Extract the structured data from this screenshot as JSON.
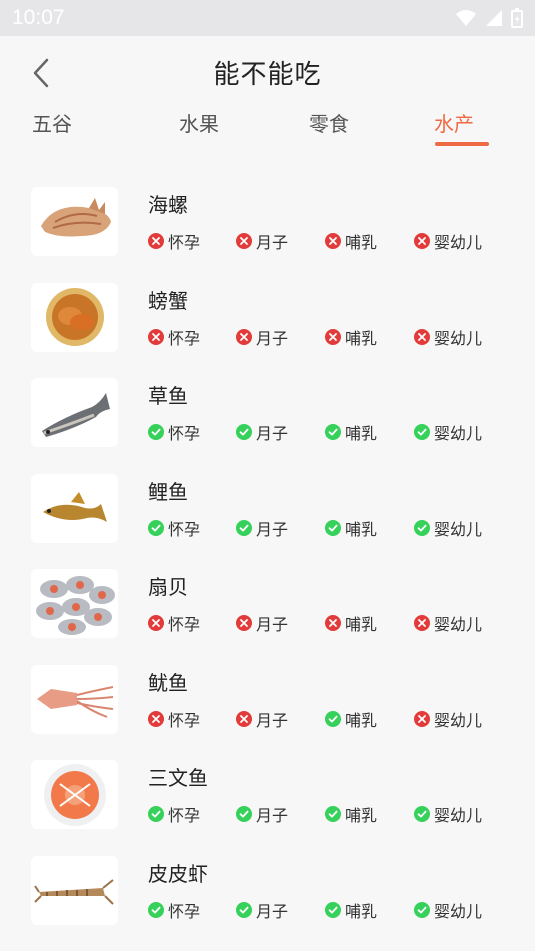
{
  "status": {
    "time": "10:07"
  },
  "header": {
    "title": "能不能吃"
  },
  "tabs": [
    {
      "label": "五谷",
      "active": false
    },
    {
      "label": "水果",
      "active": false
    },
    {
      "label": "零食",
      "active": false
    },
    {
      "label": "水产",
      "active": true
    }
  ],
  "colors": {
    "accent": "#ee6a43",
    "ok": "#36d15a",
    "no": "#e23b3b"
  },
  "items": [
    {
      "name": "海螺",
      "image": "conch-image",
      "flags": [
        {
          "label": "怀孕",
          "ok": false
        },
        {
          "label": "月子",
          "ok": false
        },
        {
          "label": "哺乳",
          "ok": false
        },
        {
          "label": "婴幼儿",
          "ok": false
        }
      ]
    },
    {
      "name": "螃蟹",
      "image": "crab-image",
      "flags": [
        {
          "label": "怀孕",
          "ok": false
        },
        {
          "label": "月子",
          "ok": false
        },
        {
          "label": "哺乳",
          "ok": false
        },
        {
          "label": "婴幼儿",
          "ok": false
        }
      ]
    },
    {
      "name": "草鱼",
      "image": "grass-carp-image",
      "flags": [
        {
          "label": "怀孕",
          "ok": true
        },
        {
          "label": "月子",
          "ok": true
        },
        {
          "label": "哺乳",
          "ok": true
        },
        {
          "label": "婴幼儿",
          "ok": true
        }
      ]
    },
    {
      "name": "鲤鱼",
      "image": "carp-image",
      "flags": [
        {
          "label": "怀孕",
          "ok": true
        },
        {
          "label": "月子",
          "ok": true
        },
        {
          "label": "哺乳",
          "ok": true
        },
        {
          "label": "婴幼儿",
          "ok": true
        }
      ]
    },
    {
      "name": "扇贝",
      "image": "scallop-image",
      "flags": [
        {
          "label": "怀孕",
          "ok": false
        },
        {
          "label": "月子",
          "ok": false
        },
        {
          "label": "哺乳",
          "ok": false
        },
        {
          "label": "婴幼儿",
          "ok": false
        }
      ]
    },
    {
      "name": "鱿鱼",
      "image": "squid-image",
      "flags": [
        {
          "label": "怀孕",
          "ok": false
        },
        {
          "label": "月子",
          "ok": false
        },
        {
          "label": "哺乳",
          "ok": true
        },
        {
          "label": "婴幼儿",
          "ok": false
        }
      ]
    },
    {
      "name": "三文鱼",
      "image": "salmon-image",
      "flags": [
        {
          "label": "怀孕",
          "ok": true
        },
        {
          "label": "月子",
          "ok": true
        },
        {
          "label": "哺乳",
          "ok": true
        },
        {
          "label": "婴幼儿",
          "ok": true
        }
      ]
    },
    {
      "name": "皮皮虾",
      "image": "mantis-shrimp-image",
      "flags": [
        {
          "label": "怀孕",
          "ok": true
        },
        {
          "label": "月子",
          "ok": true
        },
        {
          "label": "哺乳",
          "ok": true
        },
        {
          "label": "婴幼儿",
          "ok": true
        }
      ]
    }
  ]
}
